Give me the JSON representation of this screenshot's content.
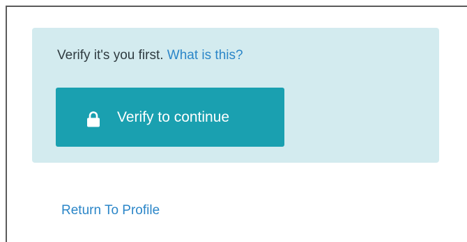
{
  "verify_panel": {
    "prompt_text": "Verify it's you first.",
    "help_link": "What is this?",
    "button_label": "Verify to continue",
    "button_icon": "lock-icon"
  },
  "footer": {
    "return_link": "Return To Profile"
  },
  "colors": {
    "panel_background": "#d3ebef",
    "button_background": "#1aa0b0",
    "link": "#2b86c8",
    "text": "#2f3b40"
  }
}
